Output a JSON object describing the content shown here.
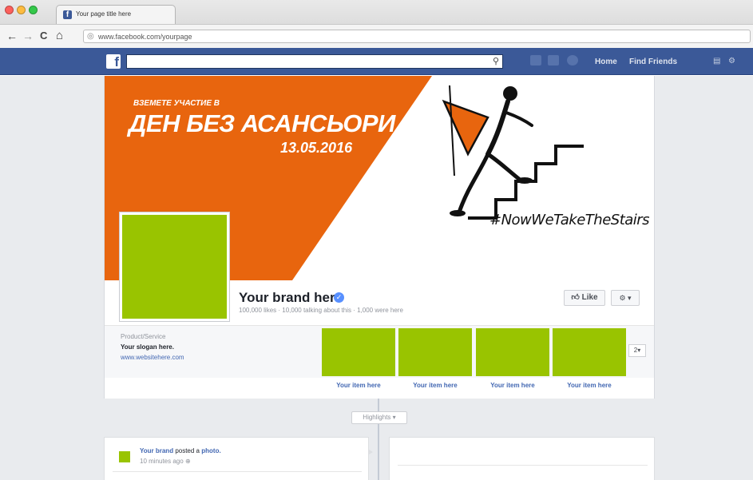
{
  "browser": {
    "tab_title": "Your page title here",
    "url": "www.facebook.com/yourpage",
    "nav": {
      "back": "←",
      "forward": "→",
      "reload": "C",
      "home": "⌂"
    }
  },
  "fb_header": {
    "logo": "f",
    "nav_links": [
      "Home",
      "Find Friends"
    ]
  },
  "cover": {
    "small_text": "ВЗЕМЕТЕ УЧАСТИЕ В",
    "big_text": "ДЕН БЕЗ АСАНСЬОРИ",
    "date": "13.05.2016",
    "hashtag": "#NowWeTakeTheStairs",
    "accent_color": "#e8650e"
  },
  "profile": {
    "brand_name": "Your brand here",
    "stats": "100,000 likes · 10,000 talking about this · 1,000 were here",
    "like_label": "Like",
    "placeholder_color": "#99c400"
  },
  "about": {
    "category": "Product/Service",
    "slogan": "Your slogan here.",
    "website": "www.websitehere.com"
  },
  "apps": {
    "items": [
      {
        "label": "Your item here"
      },
      {
        "label": "Your item here"
      },
      {
        "label": "Your item here"
      },
      {
        "label": "Your item here"
      }
    ],
    "more_label": "2"
  },
  "timeline": {
    "highlights_label": "Highlights"
  },
  "post": {
    "author": "Your brand",
    "action": "posted a",
    "object": "photo.",
    "time": "10 minutes ago"
  }
}
